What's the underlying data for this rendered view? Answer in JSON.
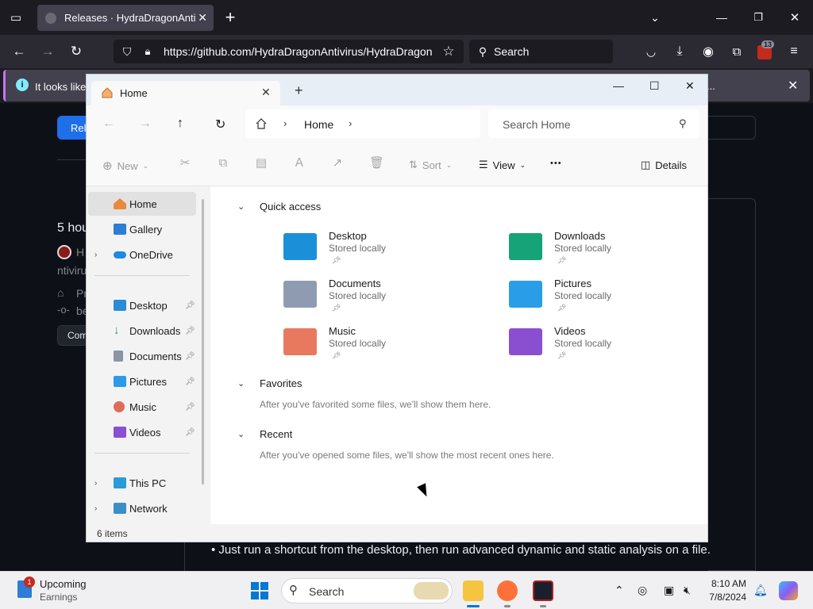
{
  "browser": {
    "tab_title": "Releases · HydraDragonAntivirus",
    "url_main": "https://github.com/HydraDragonAntivirus/HydraDragon",
    "search_label": "Search",
    "extensions_badge": "13",
    "notification_text": "It looks like",
    "notification_more": "...",
    "close_glyph": "✕",
    "new_tab_glyph": "+"
  },
  "github": {
    "button_label": "Rel",
    "release_time": "5 hou",
    "author": "H",
    "repo_frag": "ntiviru",
    "tag_frag": "Pr",
    "commit_frag": "be",
    "compare_label": "Com",
    "bullet_text": "Just run a shortcut from the desktop, then run advanced dynamic and static analysis on a file."
  },
  "explorer": {
    "tab_label": "Home",
    "breadcrumb": "Home",
    "search_placeholder": "Search Home",
    "commands": {
      "new": "New",
      "sort": "Sort",
      "view": "View",
      "more": "•••",
      "details": "Details"
    },
    "nav": {
      "items_top": [
        {
          "label": "Home",
          "icon": "home-icon",
          "color": "#e8893c"
        },
        {
          "label": "Gallery",
          "icon": "gallery-icon",
          "color": "#2d7cd6"
        },
        {
          "label": "OneDrive",
          "icon": "onedrive-icon",
          "color": "#1e88e5"
        }
      ],
      "pinned": [
        {
          "label": "Desktop",
          "icon": "desktop-icon",
          "color": "#2a8bd6"
        },
        {
          "label": "Downloads",
          "icon": "downloads-icon",
          "color": "#1f9e6e"
        },
        {
          "label": "Documents",
          "icon": "documents-icon",
          "color": "#8a94a6"
        },
        {
          "label": "Pictures",
          "icon": "pictures-icon",
          "color": "#2d9ae8"
        },
        {
          "label": "Music",
          "icon": "music-icon",
          "color": "#e06b5a"
        },
        {
          "label": "Videos",
          "icon": "videos-icon",
          "color": "#8b4fd1"
        }
      ],
      "bottom": [
        {
          "label": "This PC",
          "icon": "this-pc-icon",
          "color": "#2a9bd6"
        },
        {
          "label": "Network",
          "icon": "network-icon",
          "color": "#3b8fc9"
        }
      ]
    },
    "status_items": "6 items",
    "quick_access": {
      "title": "Quick access",
      "folders": [
        {
          "name": "Desktop",
          "sub": "Stored locally",
          "color": "#1b8fd8"
        },
        {
          "name": "Downloads",
          "sub": "Stored locally",
          "color": "#17a378"
        },
        {
          "name": "Documents",
          "sub": "Stored locally",
          "color": "#8f9bb0"
        },
        {
          "name": "Pictures",
          "sub": "Stored locally",
          "color": "#2a9de9"
        },
        {
          "name": "Music",
          "sub": "Stored locally",
          "color": "#e8795e"
        },
        {
          "name": "Videos",
          "sub": "Stored locally",
          "color": "#8a4fd0"
        }
      ]
    },
    "favorites": {
      "title": "Favorites",
      "empty": "After you've favorited some files, we'll show them here."
    },
    "recent": {
      "title": "Recent",
      "empty": "After you've opened some files, we'll show the most recent ones here."
    }
  },
  "taskbar": {
    "widget_title": "Upcoming",
    "widget_sub": "Earnings",
    "widget_badge": "1",
    "search_label": "Search",
    "time": "8:10 AM",
    "date": "7/8/2024"
  }
}
